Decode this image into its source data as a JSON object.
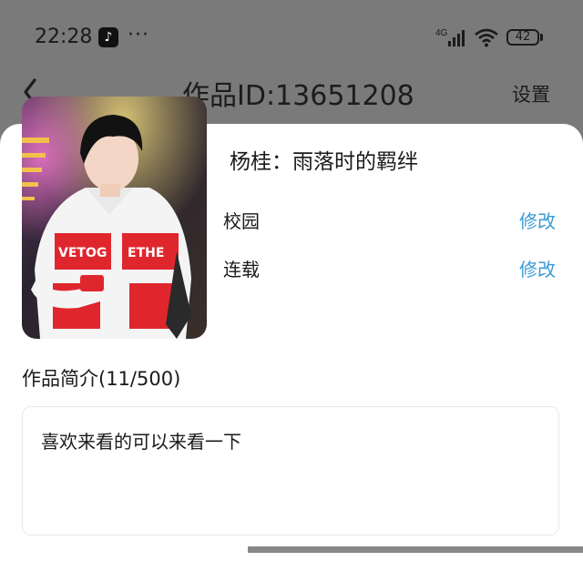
{
  "status_bar": {
    "time": "22:28",
    "network": "4G",
    "battery": "42",
    "more": "···"
  },
  "header": {
    "title": "作品ID:13651208",
    "settings": "设置"
  },
  "work": {
    "title": "杨桂：雨落时的羁绊",
    "rows": [
      {
        "label": "校园",
        "action": "修改"
      },
      {
        "label": "连载",
        "action": "修改"
      }
    ]
  },
  "intro": {
    "label": "作品简介(11/500)",
    "text": "喜欢来看的可以来看一下"
  },
  "cover_jersey_text": [
    "VETOG",
    "ETHE"
  ],
  "colors": {
    "accent": "#3b9bd4",
    "jersey_red": "#e0262d",
    "overlay": "#7a7a7a"
  }
}
